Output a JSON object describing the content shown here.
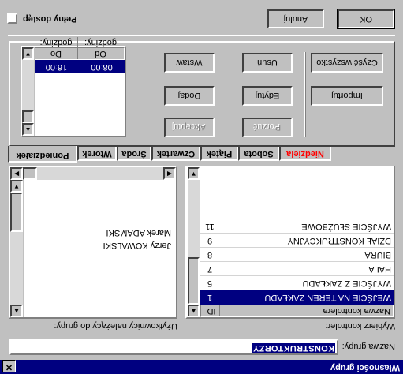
{
  "window": {
    "title": "Własności grupy",
    "close_glyph": "✕"
  },
  "group_name": {
    "label": "Nazwa grupy:",
    "value": "KONSTRUKTORZY"
  },
  "controller": {
    "label": "Wybierz kontroler:",
    "columns": {
      "name": "Nazwa kontrolera",
      "id": "ID"
    },
    "rows": [
      {
        "name": "WEJŚCIE NA TEREN ZAKŁADU",
        "id": "1"
      },
      {
        "name": "WYJŚCIE Z ZAKŁADU",
        "id": "5"
      },
      {
        "name": "HALA",
        "id": "7"
      },
      {
        "name": "BIURA",
        "id": "8"
      },
      {
        "name": "DZIAŁ KONSTRUKCYJNY",
        "id": "9"
      },
      {
        "name": "WYJŚCIE SŁUŻBOWE",
        "id": "11"
      }
    ]
  },
  "users": {
    "label": "Użytkownicy należący do grupy:",
    "items": [
      "Marek ADAMSKI",
      "Jerzy KOWALSKI"
    ]
  },
  "days": {
    "tabs": [
      "Poniedziałek",
      "Wtorek",
      "Środa",
      "Czwartek",
      "Piątek",
      "Sobota",
      "Niedziela"
    ],
    "sunday_color": "#ff0000"
  },
  "schedule": {
    "columns": {
      "from": "Od godziny:",
      "to": "Do godziny:"
    },
    "rows": [
      {
        "from": "08:00",
        "to": "16:00"
      }
    ]
  },
  "buttons": {
    "akceptuj": "Akceptuj",
    "porzuc": "Porzuć",
    "dodaj": "Dodaj",
    "edytuj": "Edytuj",
    "importuj": "Importuj",
    "wstaw": "Wstaw",
    "usun": "Usuń",
    "wyczysc": "Czyść wszystko"
  },
  "full_access": {
    "label": "Pełny dostęp",
    "checked": false
  },
  "dialog": {
    "ok": "OK",
    "cancel": "Anuluj"
  },
  "colors": {
    "selection": "#000080",
    "face": "#c0c0c0"
  }
}
